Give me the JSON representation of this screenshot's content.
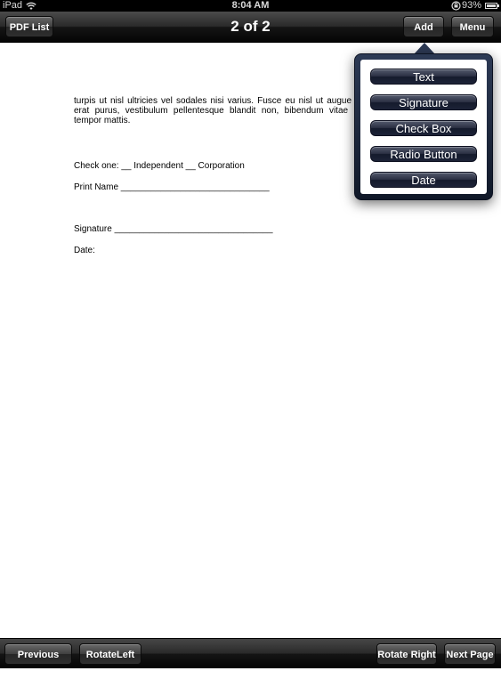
{
  "status": {
    "device": "iPad",
    "time": "8:04 AM",
    "battery": "93%"
  },
  "nav": {
    "pdf_list": "PDF List",
    "title": "2 of 2",
    "add": "Add",
    "menu": "Menu"
  },
  "document": {
    "paragraph": "turpis ut nisl ultricies vel sodales nisi varius. Fusce eu nisl ut augue mo erat purus, vestibulum pellentesque blandit non, bibendum vitae libe tempor mattis.",
    "check_one": "Check one: __ Independent  __ Corporation",
    "print_name": "Print Name ______________________________",
    "signature": "Signature ________________________________",
    "date": "Date:"
  },
  "add_menu": {
    "items": [
      "Text",
      "Signature",
      "Check Box",
      "Radio Button",
      "Date"
    ]
  },
  "toolbar": {
    "previous_page": "Previous Page",
    "rotate_left": "RotateLeft",
    "rotate_right": "Rotate Right",
    "next_page": "Next Page"
  },
  "icons": {
    "wifi": "wifi-icon",
    "orientation_lock": "orientation-lock-icon",
    "battery": "battery-icon"
  }
}
